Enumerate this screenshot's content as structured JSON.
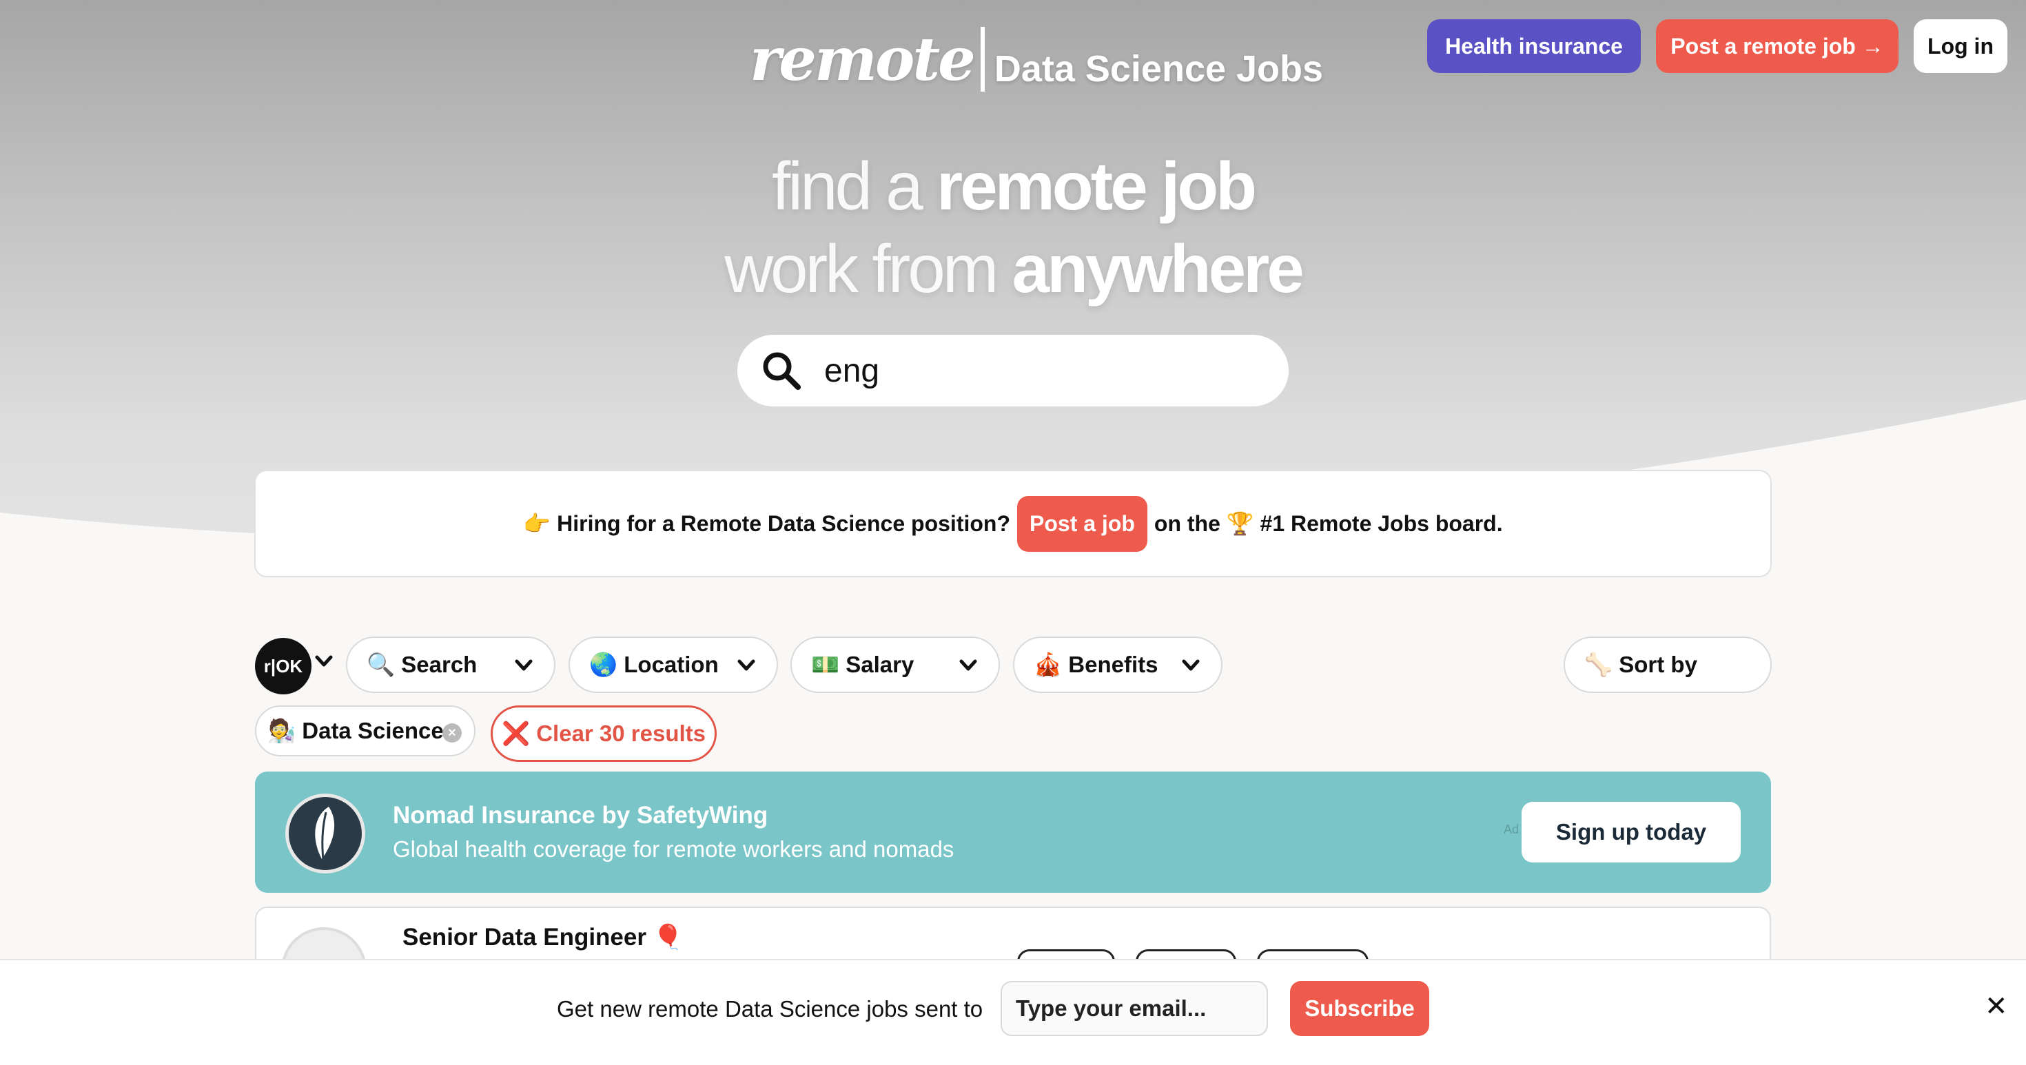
{
  "nav": {
    "logo_script": "remote",
    "logo_subtitle": "Data Science Jobs",
    "health_label": "Health insurance",
    "post_label": "Post a remote job →",
    "login_label": "Log in"
  },
  "hero": {
    "line1_light": "find a ",
    "line1_strong": "remote job",
    "line2_light": "work from ",
    "line2_strong": "anywhere",
    "search_value": "eng"
  },
  "hiring": {
    "prefix": "👉 Hiring for a Remote Data Science position?",
    "post_label": "Post a job",
    "suffix": "on the 🏆 #1 Remote Jobs board."
  },
  "filters": {
    "rok_label": "r|OK",
    "search_label": "🔍 Search",
    "location_label": "🌏 Location",
    "salary_label": "💵 Salary",
    "benefits_label": "🎪 Benefits",
    "sort_label": "🦴 Sort by",
    "active_tag": "🧑‍🔬 Data Science",
    "clear_label": "❌ Clear 30 results"
  },
  "ad": {
    "title": "Nomad Insurance by SafetyWing",
    "subtitle": "Global health coverage for remote workers and nomads",
    "ad_label": "Ad",
    "cta": "Sign up today",
    "color": "#7ac5c8"
  },
  "jobs": [
    {
      "title": "Senior Data Engineer",
      "badge": "🎈"
    }
  ],
  "subscribe": {
    "text": "Get new remote Data Science jobs sent to",
    "placeholder": "Type your email...",
    "button": "Subscribe",
    "close": "✕"
  },
  "colors": {
    "brand_red": "#ee5a4c",
    "health_purple": "#5a52c4"
  }
}
